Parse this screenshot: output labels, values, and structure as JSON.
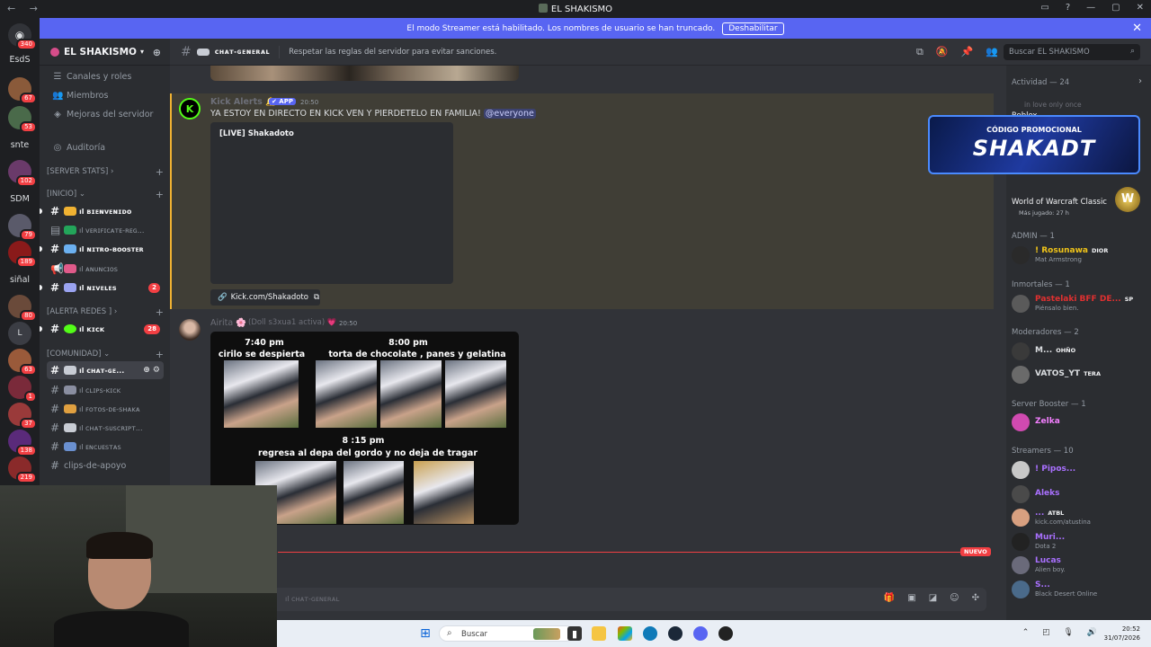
{
  "window": {
    "title": "EL SHAKISMO"
  },
  "banner": {
    "text": "El modo Streamer está habilitado. Los nombres de usuario se han truncado.",
    "button": "Deshabilitar"
  },
  "rail": {
    "home_badge": "340",
    "servers": [
      {
        "label": "EsdS",
        "text": true
      },
      {
        "label": "",
        "badge": "67"
      },
      {
        "label": "",
        "badge": "53"
      },
      {
        "label": "snte",
        "text": true
      },
      {
        "label": "",
        "badge": "102"
      },
      {
        "label": "SDM",
        "text": true
      },
      {
        "label": "",
        "badge": "79"
      },
      {
        "label": "",
        "badge": "189"
      },
      {
        "label": "siñal",
        "text": true
      },
      {
        "label": "",
        "badge": "80"
      },
      {
        "label": "L",
        "text": false
      },
      {
        "label": "",
        "badge": "63"
      },
      {
        "label": "",
        "badge": "1"
      },
      {
        "label": "",
        "badge": "37"
      },
      {
        "label": "",
        "badge": "138"
      },
      {
        "label": "",
        "badge": "219"
      }
    ]
  },
  "sidebar": {
    "guild_name": "EL SHAKISMO",
    "links": [
      "Canales y roles",
      "Miembros",
      "Mejoras del servidor",
      "Auditoría"
    ],
    "categories": [
      "[SERVER STATS]",
      "[INICIO]",
      "[ALERTA REDES ]",
      "[COMUNIDAD]"
    ],
    "channels": [
      {
        "name": "ıl ʙɪᴇɴᴠᴇɴɪᴅᴏ",
        "bold": true
      },
      {
        "name": "ıl ᴠᴇʀɪꜰɪᴄᴀᴛᴇ-ʀᴇɢ...",
        "bold": false
      },
      {
        "name": "ıl ɴɪᴛʀᴏ-ʙᴏᴏꜱᴛᴇʀ",
        "bold": true
      },
      {
        "name": "ıl ᴀɴᴜɴᴄɪᴏꜱ",
        "bold": false
      },
      {
        "name": "ıl ɴɪᴠᴇʟᴇꜱ",
        "bold": true,
        "count": "2"
      },
      {
        "name": "ıl ᴋɪᴄᴋ",
        "bold": true,
        "count": "28"
      },
      {
        "name": "ıl ᴄʜᴀᴛ-ɢᴇ...",
        "bold": true,
        "active": true
      },
      {
        "name": "ıl ᴄʟɪᴘꜱ-ᴋɪᴄᴋ",
        "bold": false
      },
      {
        "name": "ıl ꜰᴏᴛᴏꜱ-ᴅᴇ-ꜱʜᴀᴋᴀ",
        "bold": false
      },
      {
        "name": "ıl ᴄʜᴀᴛ-ꜱᴜꜱᴄʀɪᴘᴛ...",
        "bold": false
      },
      {
        "name": "ıl ᴇɴᴄᴜᴇꜱᴛᴀꜱ",
        "bold": false
      },
      {
        "name": "clips-de-apoyo",
        "bold": false
      }
    ]
  },
  "header": {
    "channel": "ᴄʜᴀᴛ-ɢᴇɴᴇʀᴀʟ",
    "topic": "Respetar las reglas del servidor para evitar sanciones.",
    "search_placeholder": "Buscar EL SHAKISMO"
  },
  "messages": {
    "kick": {
      "author": "Kick Alerts 🔔",
      "app_tag": "✔ APP",
      "time": "20:50",
      "text": "YA ESTOY EN DIRECTO EN KICK VEN Y PIERDETELO EN FAMILIA!",
      "mention": "@everyone",
      "embed_title": "[LIVE] Shakadoto",
      "link": "Kick.com/Shakadoto"
    },
    "airita": {
      "author": "Airita 🌸",
      "status": "(Doll s3xua1 activa) 💗",
      "time": "20:50",
      "meme": {
        "t1": "7:40 pm",
        "t1b": "cirilo se despierta",
        "t2": "8:00 pm",
        "t2b": "torta de chocolate , panes y gelatina",
        "t3": "8 :15 pm",
        "t3b": "regresa al depa del gordo y no deja de tragar"
      }
    },
    "new_label": "NUEVO"
  },
  "composer": {
    "placeholder": "ıl ᴄʜᴀᴛ-ɢᴇɴᴇʀᴀʟ"
  },
  "members": {
    "activity_header": "Actividad — 24",
    "activity1_user": "in love only once",
    "activity1_game": "Roblox",
    "promo_line1": "CÓDIGO PROMOCIONAL",
    "promo_line2": "SHAKADT",
    "activity2_game": "World of Warcraft Classic",
    "activity2_sub": "Más jugado: 27 h",
    "groups": [
      {
        "header": "ADMIN — 1"
      },
      {
        "header": "Inmortales — 1"
      },
      {
        "header": "Moderadores — 2"
      },
      {
        "header": "Server Booster — 1"
      },
      {
        "header": "Streamers — 10"
      }
    ],
    "list": [
      {
        "name": "! Rosunawa",
        "tag": "DIOR",
        "sub": "Mat Armstrong",
        "color": "#f0c419"
      },
      {
        "name": "Pastelaki BFF DE...",
        "tag": "SP",
        "sub": "Piénsalo bien.",
        "color": "#e03030"
      },
      {
        "name": "M...",
        "tag": "OHÑO",
        "sub": "",
        "color": "#dbdee1"
      },
      {
        "name": "VATOS_YT",
        "tag": "TERA",
        "sub": "",
        "color": "#dbdee1"
      },
      {
        "name": "Zelka",
        "tag": "",
        "sub": "",
        "color": "#f47fff"
      },
      {
        "name": "! Pipos...",
        "tag": "",
        "sub": "",
        "color": "#a970ff"
      },
      {
        "name": "Aleks",
        "tag": "",
        "sub": "",
        "color": "#a970ff"
      },
      {
        "name": "...",
        "tag": "ATBL",
        "sub": "kick.com/atustina",
        "color": "#a970ff"
      },
      {
        "name": "Muri...",
        "tag": "",
        "sub": "Dota 2",
        "color": "#a970ff"
      },
      {
        "name": "Lucas",
        "tag": "",
        "sub": "Alien boy.",
        "color": "#a970ff"
      },
      {
        "name": "S...",
        "tag": "",
        "sub": "Black Desert Online",
        "color": "#a970ff"
      }
    ]
  },
  "taskbar": {
    "search": "Buscar",
    "time": "20:52",
    "date": "31/07/2026"
  }
}
